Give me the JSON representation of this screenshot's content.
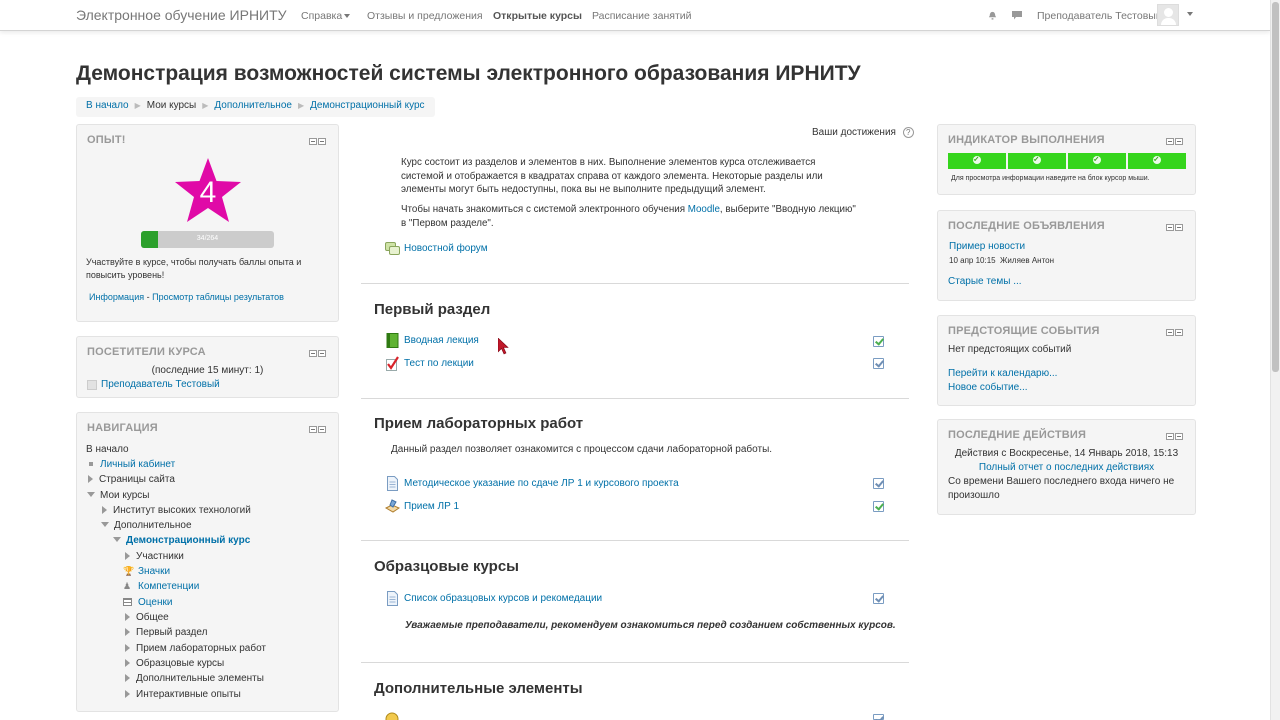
{
  "navbar": {
    "brand": "Электронное обучение ИРНИТУ",
    "items": [
      "Справка",
      "Отзывы и предложения",
      "Открытые курсы",
      "Расписание занятий"
    ],
    "user": "Преподаватель Тестовый"
  },
  "page": {
    "title": "Демонстрация возможностей системы электронного образования ИРНИТУ",
    "breadcrumb": [
      "В начало",
      "Мои курсы",
      "Дополнительное",
      "Демонстрационный курс"
    ]
  },
  "xp_block": {
    "title": "ОПЫТ!",
    "level": "4",
    "progress_text": "34/264",
    "progress_fraction": 0.13,
    "description": "Участвуйте в курсе, чтобы получать баллы опыта и повысить уровень!",
    "link_info": "Информация",
    "link_sep": " - ",
    "link_table": "Просмотр таблицы результатов",
    "star_color": "#e00aa7"
  },
  "visitors_block": {
    "title": "ПОСЕТИТЕЛИ КУРСА",
    "subtitle": "(последние 15 минут: 1)",
    "user": "Преподаватель Тестовый"
  },
  "navigation_block": {
    "title": "НАВИГАЦИЯ",
    "home": "В начало",
    "items": [
      "Личный кабинет",
      "Страницы сайта",
      "Мои курсы",
      "Институт высоких технологий",
      "Дополнительное",
      "Демонстрационный курс",
      "Участники",
      "Значки",
      "Компетенции",
      "Оценки",
      "Общее",
      "Первый раздел",
      "Прием лабораторных работ",
      "Образцовые курсы",
      "Дополнительные элементы",
      "Интерактивные опыты"
    ]
  },
  "main": {
    "achievements": "Ваши достижения",
    "intro_p1": "Курс состоит из разделов и элементов в них. Выполнение элементов курса отслеживается системой и отображается в квадратах справа от каждого элемента. Некоторые разделы или элементы могут быть недоступны, пока вы не выполните предыдущий элемент.",
    "intro_p2_a": "Чтобы начать знакомиться с системой электронного обучения ",
    "intro_p2_link": "Moodle",
    "intro_p2_b": ", выберите \"Вводную лекцию\" в \"Первом разделе\".",
    "news_forum": "Новостной форум",
    "sections": [
      {
        "title": "Первый раздел",
        "activities": [
          "Вводная лекция",
          "Тест по лекции"
        ]
      },
      {
        "title": "Прием лабораторных работ",
        "summary": "Данный раздел позволяет ознакомится с процессом сдачи лабораторной работы.",
        "activities": [
          "Методическое указание по сдаче ЛР 1 и курсового проекта",
          "Прием ЛР 1"
        ]
      },
      {
        "title": "Образцовые курсы",
        "activities": [
          "Список образцовых курсов и рекомедации"
        ],
        "note": "Уважаемые преподаватели, рекомендуем ознакомиться перед созданием собственных курсов."
      },
      {
        "title": "Дополнительные элементы"
      }
    ]
  },
  "completion_block": {
    "title": "ИНДИКАТОР ВЫПОЛНЕНИЯ",
    "segments": 4,
    "hint": "Для просмотра информации наведите на блок курсор мыши.",
    "color": "#35d51c"
  },
  "news_block": {
    "title": "ПОСЛЕДНИЕ ОБЪЯВЛЕНИЯ",
    "item_title": "Пример новости",
    "item_meta": "10 апр 10:15  Жиляев Антон",
    "older": "Старые темы ..."
  },
  "events_block": {
    "title": "ПРЕДСТОЯЩИЕ СОБЫТИЯ",
    "empty": "Нет предстоящих событий",
    "calendar_link": "Перейти к календарю...",
    "new_event": "Новое событие..."
  },
  "activity_block": {
    "title": "ПОСЛЕДНИЕ ДЕЙСТВИЯ",
    "since": "Действия с Воскресенье, 14 Январь 2018, 15:13",
    "full_report": "Полный отчет о последних действиях",
    "nothing": "Со времени Вашего последнего входа ничего не произошло"
  }
}
